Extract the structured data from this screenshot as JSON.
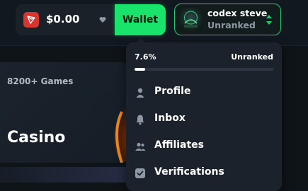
{
  "header": {
    "balance": "$0.00",
    "wallet_label": "Wallet",
    "user": {
      "name": "codex steve",
      "rank": "Unranked"
    }
  },
  "casino_card": {
    "games_count": "8200+ Games",
    "title": "Casino"
  },
  "dropdown": {
    "progress": {
      "percent_label": "7.6%",
      "value": 0.076,
      "rank": "Unranked"
    },
    "items": [
      {
        "label": "Profile",
        "icon": "user-icon"
      },
      {
        "label": "Inbox",
        "icon": "bell-icon"
      },
      {
        "label": "Affiliates",
        "icon": "users-icon"
      },
      {
        "label": "Verifications",
        "icon": "check-square-icon"
      }
    ]
  },
  "colors": {
    "accent_green": "#1ae36c",
    "token_red": "#d8352f",
    "panel": "#1b222b"
  }
}
